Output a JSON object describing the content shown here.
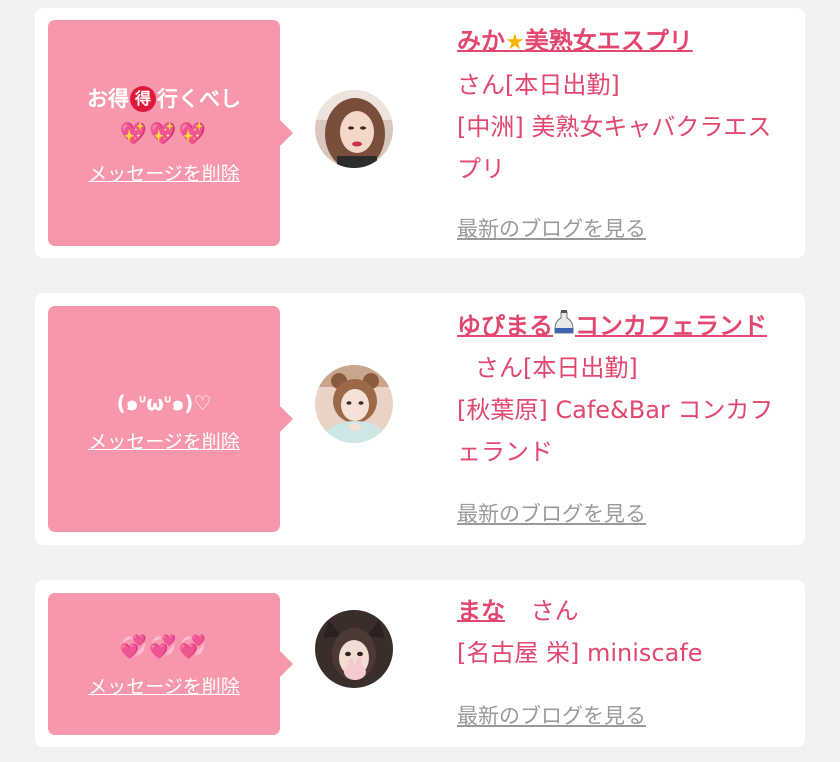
{
  "cards": [
    {
      "message_text": "お得",
      "message_badge": "得",
      "message_text_after": "行くべし",
      "message_icons": "💖💖💖",
      "delete_label": "メッセージを削除",
      "name_part1": "みか",
      "name_icon": "star-icon",
      "name_part2": "美熟女エスプリ",
      "san_suffix": "さん[本日出勤]",
      "shop": "[中洲] 美熟女キャバクラエスプリ",
      "blog_label": "最新のブログを見る"
    },
    {
      "message_text": "(๑ᐡωᐡ๑)♡",
      "delete_label": "メッセージを削除",
      "name_part1": "ゆぴまる",
      "name_icon": "sake-icon",
      "name_part2": "コンカフェランド",
      "san_suffix": "さん[本日出勤]",
      "shop": "[秋葉原] Cafe&Bar コンカフェランド",
      "blog_label": "最新のブログを見る"
    },
    {
      "message_icons": "💞💞💞",
      "delete_label": "メッセージを削除",
      "name_part1": "まな",
      "san_suffix": "さん",
      "shop": "[名古屋 栄] miniscafe",
      "blog_label": "最新のブログを見る"
    }
  ],
  "colors": {
    "background": "#f2f2f2",
    "card": "#ffffff",
    "bubble": "#f797ab",
    "accent_text": "#e2476f",
    "blog_link": "#9a9a9a",
    "badge": "#e0193a"
  }
}
